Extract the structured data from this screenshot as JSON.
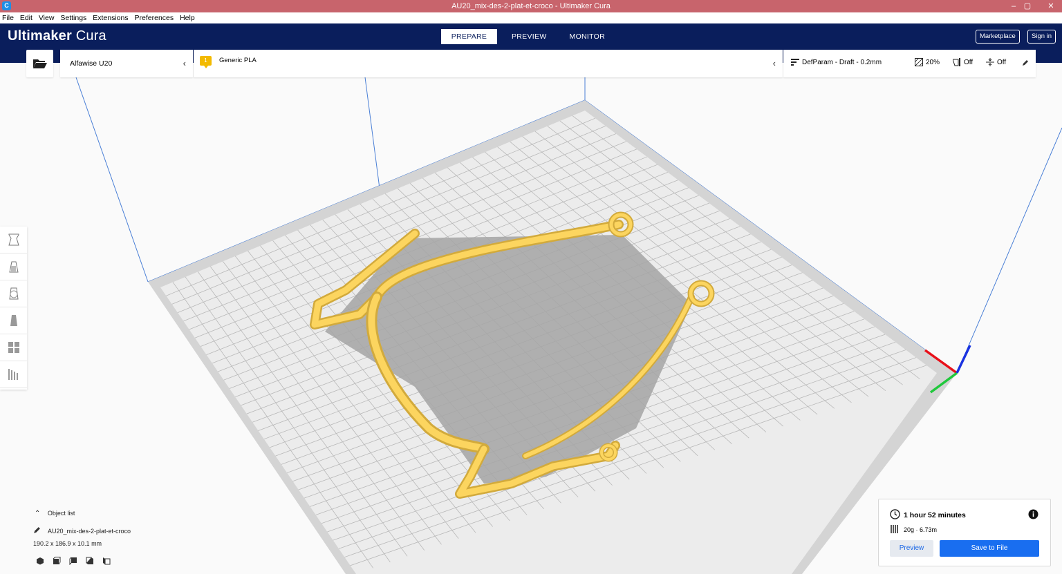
{
  "window": {
    "title": "AU20_mix-des-2-plat-et-croco - Ultimaker Cura",
    "icon_glyph": "C",
    "controls": [
      "–",
      "▢",
      "✕"
    ]
  },
  "menu": [
    "File",
    "Edit",
    "View",
    "Settings",
    "Extensions",
    "Preferences",
    "Help"
  ],
  "header": {
    "logo_bold": "Ultimaker",
    "logo_light": " Cura",
    "stages": [
      "PREPARE",
      "PREVIEW",
      "MONITOR"
    ],
    "active_stage": "PREPARE",
    "marketplace": "Marketplace",
    "signin": "Sign in",
    "bg_color": "#0a1e5c"
  },
  "printer": {
    "name": "Alfawise U20"
  },
  "material": {
    "extruder_number": "1",
    "name": "Generic PLA",
    "badge_color": "#f3ba00"
  },
  "print_settings": {
    "profile": "DefParam - Draft - 0.2mm",
    "infill": "20%",
    "support": "Off",
    "adhesion": "Off"
  },
  "tools": [
    "move-tool",
    "scale-tool",
    "rotate-tool",
    "mirror-tool",
    "per-model-settings-tool",
    "support-blocker-tool"
  ],
  "object_list": {
    "header": "Object list",
    "object_name": "AU20_mix-des-2-plat-et-croco",
    "dimensions": "190.2 x 186.9 x 10.1 mm",
    "view_icons": [
      "3d-view-icon",
      "front-view-icon",
      "top-view-icon",
      "left-view-icon",
      "right-view-icon"
    ]
  },
  "print_info": {
    "time": "1 hour 52 minutes",
    "material_usage": "20g · 6.73m",
    "preview_button": "Preview",
    "save_button": "Save to File",
    "accent": "#196ef0"
  },
  "model_color": "#fcd55f",
  "build_plate_color": "#dcdcdc"
}
